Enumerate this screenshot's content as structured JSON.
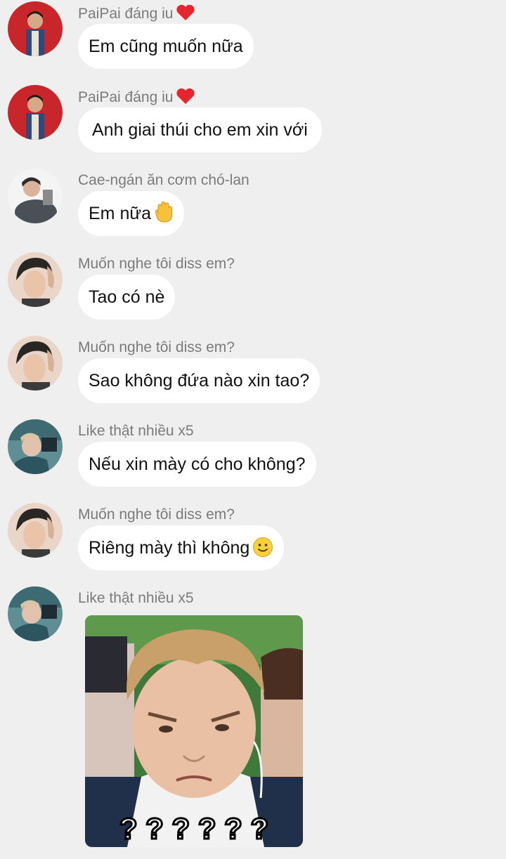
{
  "messages": [
    {
      "sender": "PaiPai đáng iu",
      "text": "Em cũng muốn nữa"
    },
    {
      "sender": "PaiPai đáng iu",
      "text": "Anh giai thúi cho em xin với"
    },
    {
      "sender": "Cae-ngán ăn cơm chó-lan",
      "text": "Em nữa"
    },
    {
      "sender": "Muốn nghe tôi diss em?",
      "text": "Tao có nè"
    },
    {
      "sender": "Muốn nghe tôi diss em?",
      "text": "Sao không đứa nào xin tao?"
    },
    {
      "sender": "Like thật nhiều x5",
      "text": "Nếu xin mày có cho không?"
    },
    {
      "sender": "Muốn nghe tôi diss em?",
      "text": "Riêng mày thì không"
    },
    {
      "sender": "Like thật nhiều x5",
      "image_caption": "? ? ? ? ? ?"
    }
  ],
  "icons": {
    "heart": "heart-icon",
    "raised_hand": "raised-hand-emoji",
    "smile": "smile-emoji"
  },
  "colors": {
    "background": "#efefef",
    "bubble": "#ffffff",
    "sender_name": "#7b7b7b",
    "heart": "#e52630"
  }
}
